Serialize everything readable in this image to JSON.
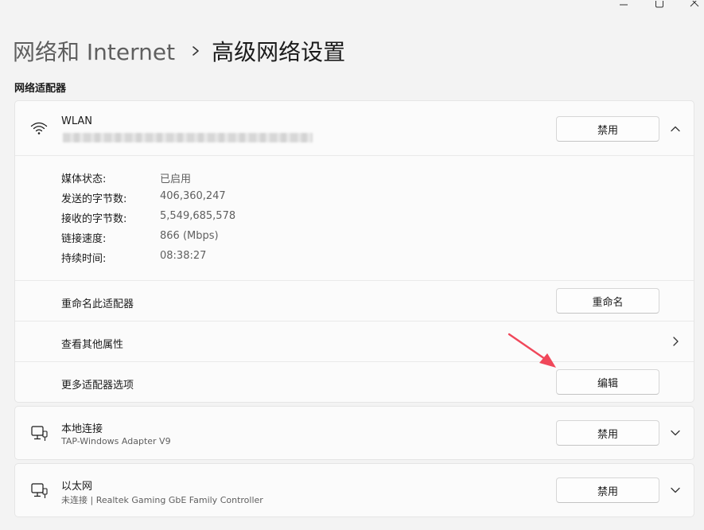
{
  "breadcrumb": {
    "parent": "网络和 Internet",
    "current": "高级网络设置"
  },
  "section_title": "网络适配器",
  "wlan": {
    "name": "WLAN",
    "disable_label": "禁用",
    "properties": [
      {
        "label": "媒体状态:",
        "value": "已启用"
      },
      {
        "label": "发送的字节数:",
        "value": "406,360,247"
      },
      {
        "label": "接收的字节数:",
        "value": "5,549,685,578"
      },
      {
        "label": "链接速度:",
        "value": "866 (Mbps)"
      },
      {
        "label": "持续时间:",
        "value": "08:38:27"
      }
    ],
    "rename": {
      "label": "重命名此适配器",
      "button": "重命名"
    },
    "more_props": {
      "label": "查看其他属性"
    },
    "more_options": {
      "label": "更多适配器选项",
      "button": "编辑"
    }
  },
  "local": {
    "name": "本地连接",
    "subtitle": "TAP-Windows Adapter V9",
    "disable_label": "禁用"
  },
  "ethernet": {
    "name": "以太网",
    "subtitle": "未连接 | Realtek Gaming GbE Family Controller",
    "disable_label": "禁用"
  },
  "colors": {
    "accent_arrow": "#f0475a",
    "background": "#f3f3f3",
    "card": "#fbfbfb"
  },
  "icons": [
    "wifi-icon",
    "ethernet-adapter-icon",
    "chevron-up-icon",
    "chevron-down-icon",
    "chevron-right-icon",
    "minimize-icon",
    "maximize-icon",
    "close-icon",
    "annotation-arrow-icon"
  ]
}
